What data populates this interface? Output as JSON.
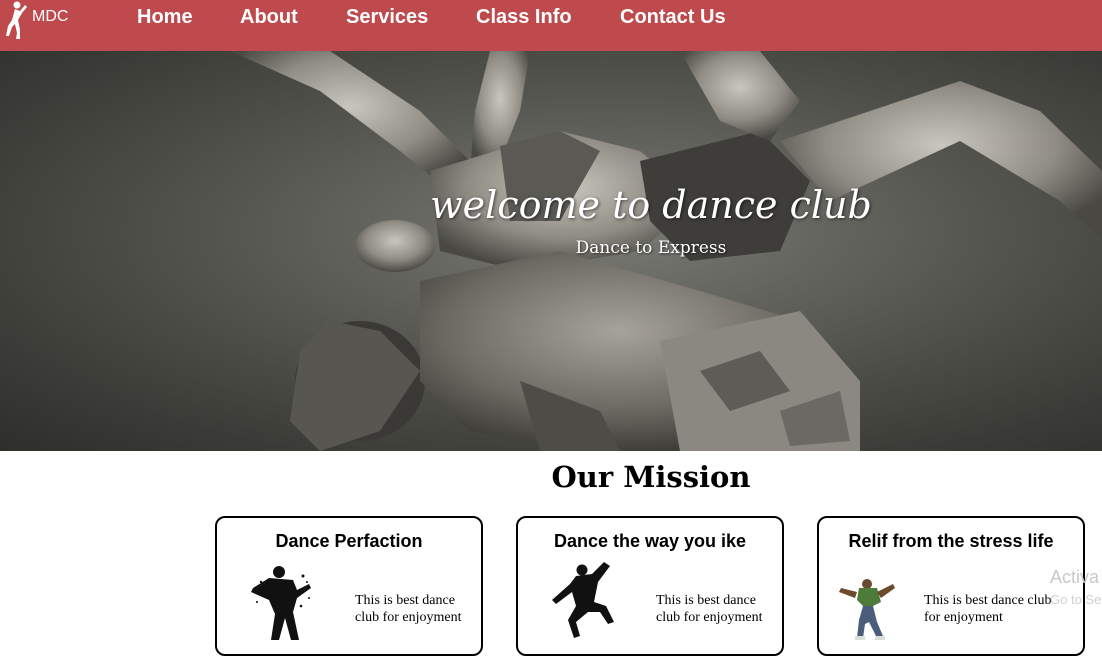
{
  "nav": {
    "brand": "MDC",
    "links": [
      "Home",
      "About",
      "Services",
      "Class Info",
      "Contact Us"
    ]
  },
  "hero": {
    "title": "welcome to dance club",
    "subtitle": "Dance to Express"
  },
  "mission": {
    "title": "Our Mission",
    "cards": [
      {
        "title": "Dance Perfaction",
        "text": "This is best dance club for enjoyment"
      },
      {
        "title": "Dance the way you ike",
        "text": "This is best dance club for enjoyment"
      },
      {
        "title": "Relif from the stress life",
        "text": "This is best dance club for enjoyment"
      }
    ]
  },
  "watermark": {
    "line1": "Activa",
    "line2": "Go to Se"
  },
  "colors": {
    "navbar": "#bf4a4d",
    "nav_text": "#ffffff"
  }
}
